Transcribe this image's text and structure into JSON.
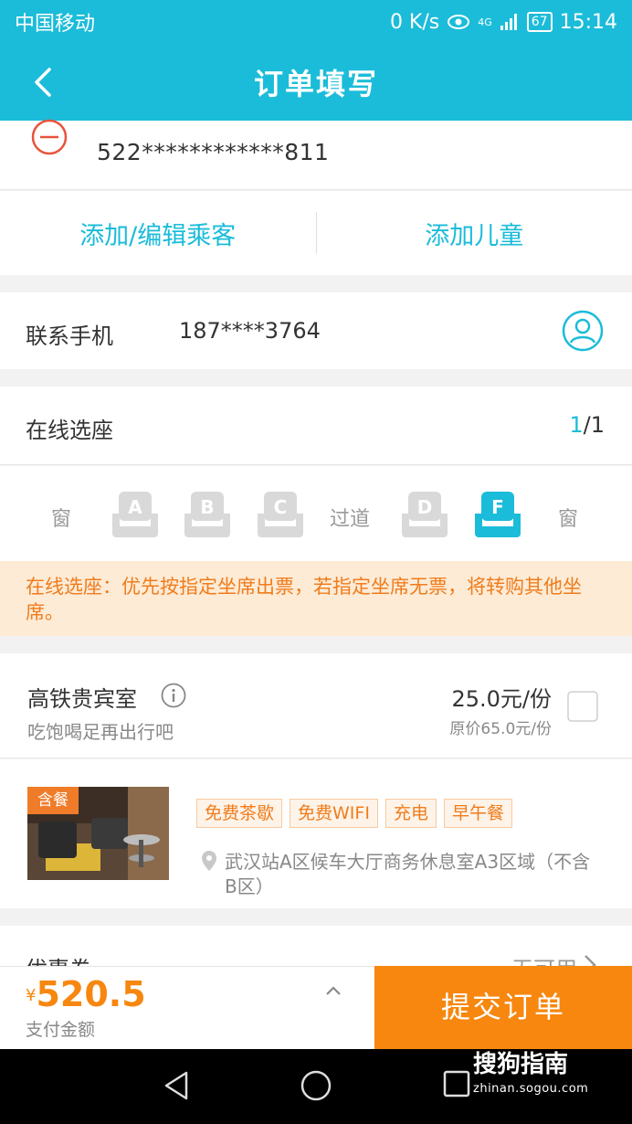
{
  "status_bar": {
    "carrier": "中国移动",
    "speed": "0 K/s",
    "network": "4G",
    "battery": "67",
    "time": "15:14"
  },
  "nav": {
    "title": "订单填写"
  },
  "passenger": {
    "id_number": "522************811"
  },
  "actions": {
    "add_edit": "添加/编辑乘客",
    "add_child": "添加儿童"
  },
  "contact": {
    "label": "联系手机",
    "phone": "187****3764"
  },
  "seat_select": {
    "label": "在线选座",
    "selected": "1",
    "total": "/1",
    "window_left": "窗",
    "aisle": "过道",
    "window_right": "窗",
    "seats": [
      {
        "letter": "A",
        "selected": false
      },
      {
        "letter": "B",
        "selected": false
      },
      {
        "letter": "C",
        "selected": false
      },
      {
        "letter": "D",
        "selected": false
      },
      {
        "letter": "F",
        "selected": true
      }
    ],
    "notice": "在线选座：优先按指定坐席出票，若指定坐席无票，将转购其他坐席。"
  },
  "lounge": {
    "name": "高铁贵宾室",
    "desc": "吃饱喝足再出行吧",
    "price": "25.0元/份",
    "original_price": "原价65.0元/份",
    "package_badge": "含餐",
    "tags": [
      "免费茶歇",
      "免费WIFI",
      "充电",
      "早午餐"
    ],
    "location": "武汉站A区候车大厅商务休息室A3区域（不含B区）"
  },
  "coupon": {
    "label": "优惠券",
    "value": "无可用"
  },
  "payment": {
    "currency": "¥",
    "amount": "520.5",
    "label": "支付金额",
    "submit": "提交订单"
  },
  "watermark": {
    "brand": "搜狗指南",
    "url": "zhinan.sogou.com"
  },
  "colors": {
    "primary": "#1bbcd9",
    "accent_orange": "#f7870f",
    "notice_bg": "#fdebd6"
  }
}
